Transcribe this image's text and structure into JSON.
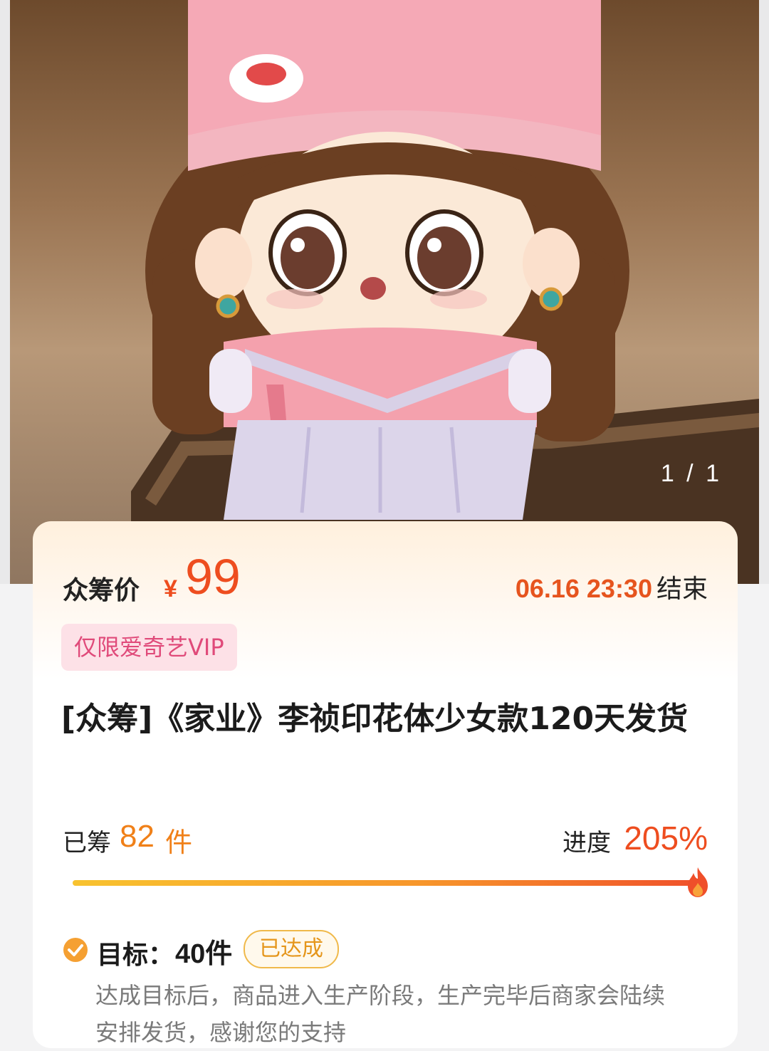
{
  "gallery": {
    "pager": "1 / 1"
  },
  "price": {
    "label": "众筹价",
    "currency": "¥",
    "value": "99"
  },
  "deadline": {
    "time": "06.16 23:30",
    "label": "结束"
  },
  "badge": {
    "vip": "仅限爱奇艺VIP"
  },
  "product": {
    "title": "[众筹]《家业》李祯印花体少女款120天发货"
  },
  "stats": {
    "raised_label": "已筹",
    "raised_count": "82",
    "raised_unit": "件",
    "progress_label": "进度",
    "progress_value": "205%",
    "progress_fraction": 1.0
  },
  "goal": {
    "label": "目标：",
    "value": "40件",
    "status": "已达成",
    "note": "达成目标后，商品进入生产阶段，生产完毕后商家会陆续安排发货，感谢您的支持"
  },
  "colors": {
    "accent": "#ee4d1f",
    "orange": "#f08018",
    "vip_text": "#e04a7a",
    "vip_bg": "#fde1e7",
    "achieved": "#e5961b"
  },
  "icons": {
    "goal_status": "check-circle-icon",
    "progress_end": "flame-icon"
  }
}
